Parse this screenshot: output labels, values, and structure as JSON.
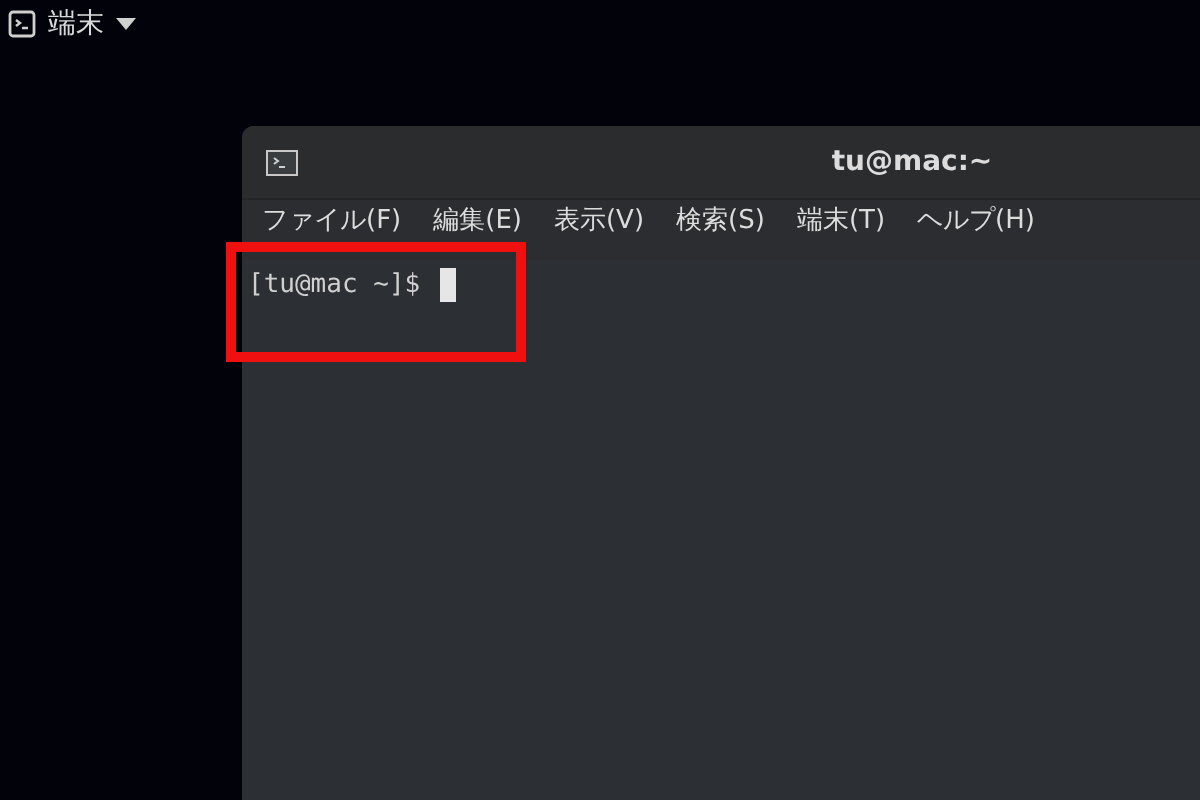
{
  "top_bar": {
    "app_menu": "端末"
  },
  "window": {
    "title": "tu@mac:~"
  },
  "menu_bar": [
    {
      "label": "ファイル(F)"
    },
    {
      "label": "編集(E)"
    },
    {
      "label": "表示(V)"
    },
    {
      "label": "検索(S)"
    },
    {
      "label": "端末(T)"
    },
    {
      "label": "ヘルプ(H)"
    }
  ],
  "terminal": {
    "prompt": "[tu@mac ~]$"
  }
}
